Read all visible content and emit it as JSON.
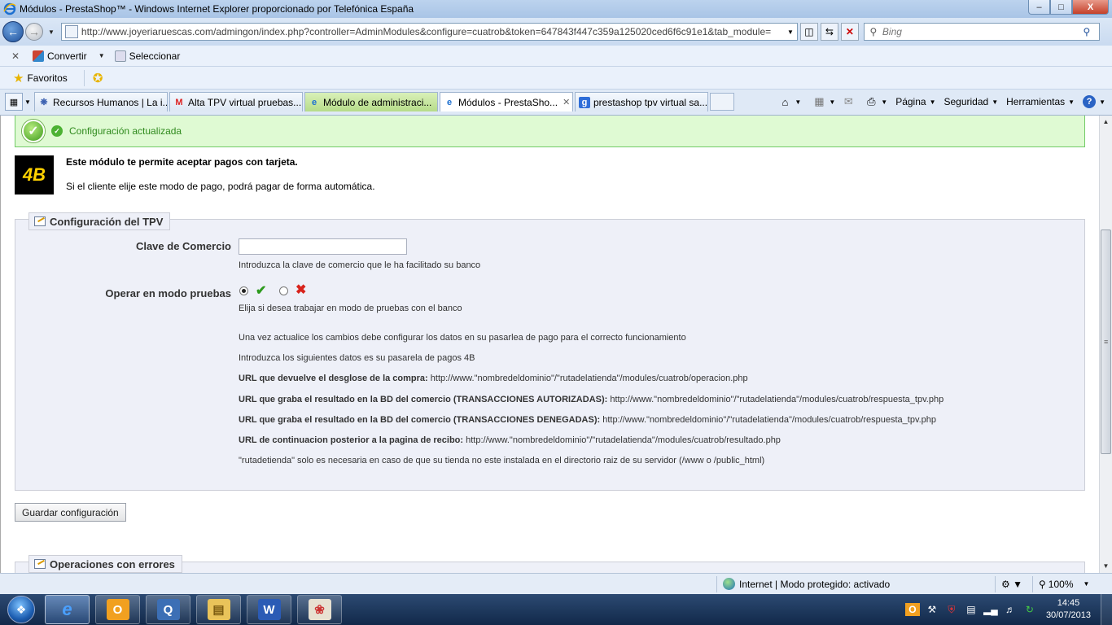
{
  "window": {
    "title": "Módulos - PrestaShop™ - Windows Internet Explorer proporcionado por Telefónica España",
    "min_label": "–",
    "max_label": "□",
    "close_label": "X"
  },
  "address": {
    "url": "http://www.joyeriaruescas.com/admingon/index.php?controller=AdminModules&configure=cuatrob&token=647843f447c359a125020ced6f6c91e1&tab_module=",
    "search_placeholder": "Bing"
  },
  "commandbar": {
    "convert_label": "Convertir",
    "select_label": "Seleccionar"
  },
  "favorites": {
    "label": "Favoritos"
  },
  "tabs": [
    {
      "label": "Recursos Humanos | La i...",
      "icon": "gear-icon"
    },
    {
      "label": "Alta TPV virtual pruebas...",
      "icon": "gmail-icon"
    },
    {
      "label": "Módulo de administraci...",
      "icon": "ie-icon"
    },
    {
      "label": "Módulos - PrestaSho...",
      "icon": "ie-icon",
      "active": true
    },
    {
      "label": "prestashop tpv virtual sa...",
      "icon": "google-icon"
    }
  ],
  "tools": {
    "page_label": "Página",
    "security_label": "Seguridad",
    "tools_label": "Herramientas"
  },
  "content": {
    "success_message": "Configuración actualizada",
    "module_title": "Este módulo te permite aceptar pagos con tarjeta.",
    "module_desc": "Si el cliente elije este modo de pago, podrá pagar de forma automática.",
    "fieldset_title": "Configuración del TPV",
    "clave_label": "Clave de Comercio",
    "clave_value": "",
    "clave_hint": "Introduzca la clave de comercio que le ha facilitado su banco",
    "test_label": "Operar en modo pruebas",
    "test_value": "yes",
    "test_hint": "Elija si desea trabajar en modo de pruebas con el banco",
    "info1": "Una vez actualice los cambios debe configurar los datos en su pasarlea de pago para el correcto funcionamiento",
    "info2": "Introduzca los siguientes datos es su pasarela de pagos 4B",
    "url_rows": [
      {
        "label": "URL que devuelve el desglose de la compra:",
        "value": " http://www.\"nombredeldominio\"/\"rutadelatienda\"/modules/cuatrob/operacion.php"
      },
      {
        "label": "URL que graba el resultado en la BD del comercio (TRANSACCIONES AUTORIZADAS):",
        "value": " http://www.\"nombredeldominio\"/\"rutadelatienda\"/modules/cuatrob/respuesta_tpv.php"
      },
      {
        "label": "URL que graba el resultado en la BD del comercio (TRANSACCIONES DENEGADAS):",
        "value": " http://www.\"nombredeldominio\"/\"rutadelatienda\"/modules/cuatrob/respuesta_tpv.php"
      },
      {
        "label": "URL de continuacion posterior a la pagina de recibo:",
        "value": " http://www.\"nombredeldominio\"/\"rutadelatienda\"/modules/cuatrob/resultado.php"
      }
    ],
    "info_footer": "\"rutadetienda\" solo es necesaria en caso de que su tienda no este instalada en el directorio raiz de su servidor (/www o /public_html)",
    "save_button": "Guardar configuración",
    "fieldset2_title": "Operaciones con errores"
  },
  "statusbar": {
    "zone": "Internet | Modo protegido: activado",
    "zoom": "100%"
  },
  "taskbar": {
    "time": "14:45",
    "date": "30/07/2013",
    "apps": [
      "ie-icon",
      "outlook-icon",
      "remote-desktop-icon",
      "explorer-icon",
      "word-icon",
      "paint-icon"
    ]
  },
  "colors": {
    "success_bg": "#dffad3",
    "success_text": "#2f8a1d",
    "fieldset_bg": "#eef0f8",
    "logo_yellow": "#ffd200"
  }
}
